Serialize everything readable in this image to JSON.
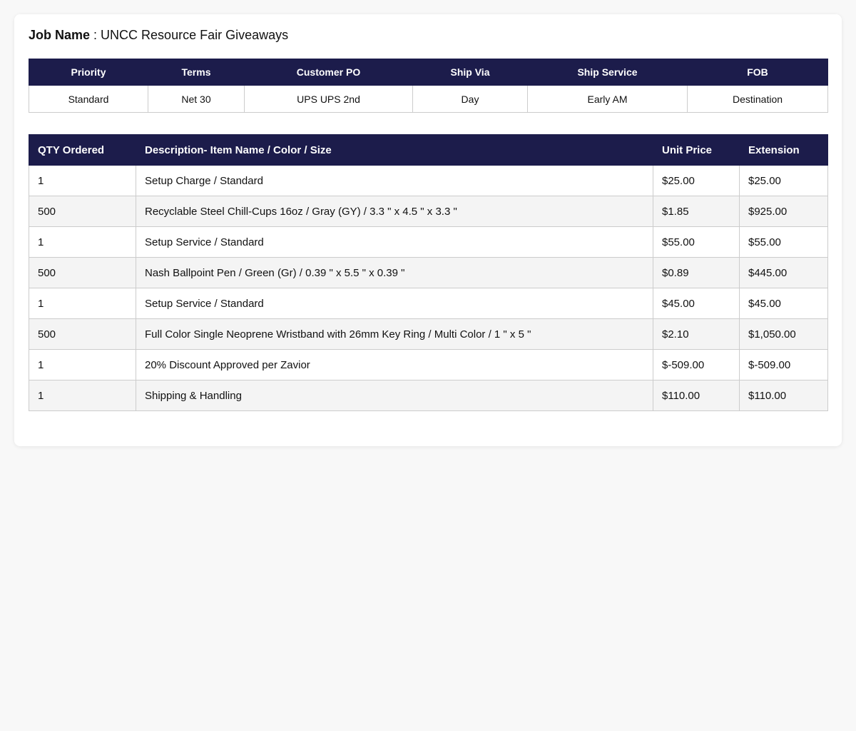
{
  "job": {
    "label": "Job Name",
    "separator": " : ",
    "value": "UNCC Resource Fair Giveaways"
  },
  "meta": {
    "headers": [
      "Priority",
      "Terms",
      "Customer PO",
      "Ship Via",
      "Ship Service",
      "FOB"
    ],
    "values": [
      "Standard",
      "Net 30",
      "UPS UPS 2nd",
      "Day",
      "Early AM",
      "Destination"
    ]
  },
  "items": {
    "headers": {
      "qty": "QTY Ordered",
      "description": "Description- Item Name / Color / Size",
      "unit_price": "Unit Price",
      "extension": "Extension"
    },
    "rows": [
      {
        "qty": "1",
        "description": "Setup Charge / Standard",
        "unit_price": "$25.00",
        "extension": "$25.00"
      },
      {
        "qty": "500",
        "description": "Recyclable Steel Chill-Cups 16oz / Gray (GY) / 3.3 \" x 4.5 \" x 3.3 \"",
        "unit_price": "$1.85",
        "extension": "$925.00"
      },
      {
        "qty": "1",
        "description": "Setup Service / Standard",
        "unit_price": "$55.00",
        "extension": "$55.00"
      },
      {
        "qty": "500",
        "description": "Nash Ballpoint Pen / Green (Gr) / 0.39 \" x 5.5 \" x 0.39 \"",
        "unit_price": "$0.89",
        "extension": "$445.00"
      },
      {
        "qty": "1",
        "description": "Setup Service / Standard",
        "unit_price": "$45.00",
        "extension": "$45.00"
      },
      {
        "qty": "500",
        "description": "Full Color Single Neoprene Wristband with 26mm Key Ring / Multi Color / 1 \" x 5 \"",
        "unit_price": "$2.10",
        "extension": "$1,050.00"
      },
      {
        "qty": "1",
        "description": "20% Discount Approved per Zavior",
        "unit_price": "$-509.00",
        "extension": "$-509.00"
      },
      {
        "qty": "1",
        "description": "Shipping & Handling",
        "unit_price": "$110.00",
        "extension": "$110.00"
      }
    ]
  },
  "colors": {
    "header_bg": "#1c1c4b",
    "header_text": "#ffffff",
    "row_alt": "#f4f4f4",
    "page_bg": "#f8f8f8"
  }
}
